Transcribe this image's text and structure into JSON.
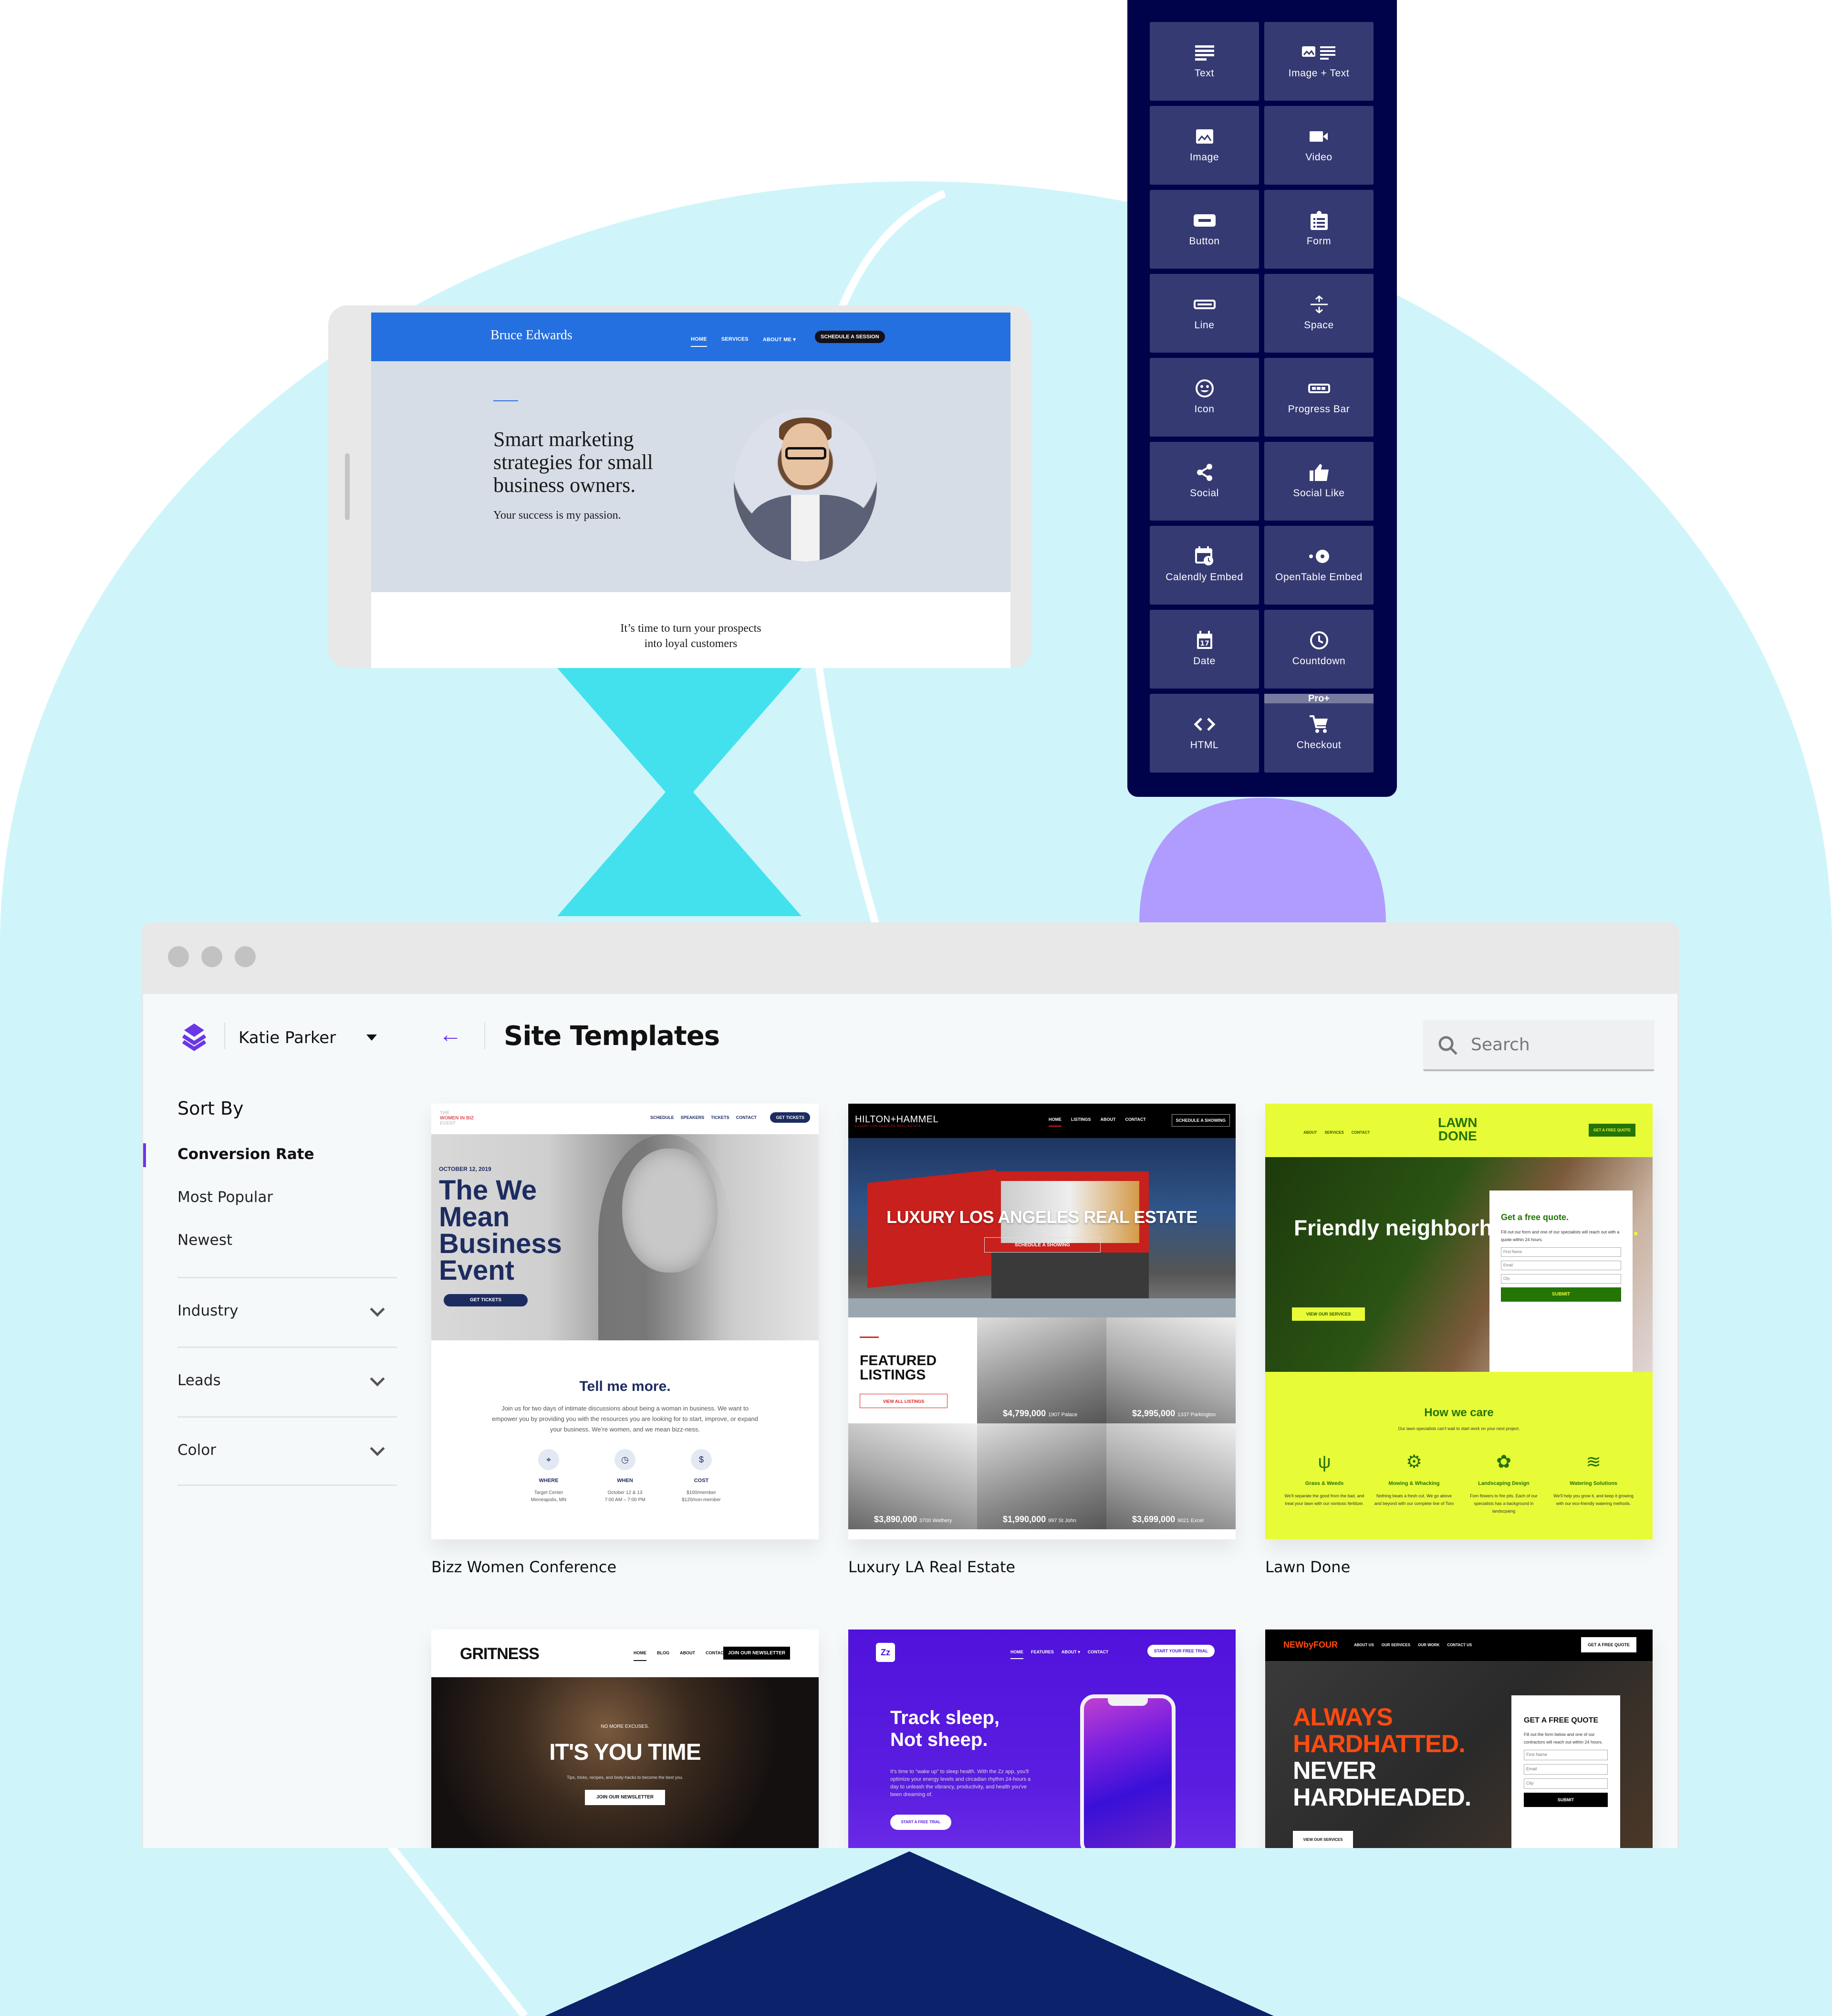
{
  "colors": {
    "background_arch": "#cff5fa",
    "widget_panel": "#00034a",
    "widget_tile": "#363a72",
    "accent_purple": "#6a36e6",
    "hourglass_cyan": "#43e1ee",
    "lavender": "#b09cff",
    "navy_triangle": "#0c226b"
  },
  "tablet_preview": {
    "site_name": "Bruce Edwards",
    "nav": [
      "HOME",
      "SERVICES",
      "ABOUT ME ▾"
    ],
    "cta": "SCHEDULE A SESSION",
    "headline": "Smart marketing strategies for small business owners.",
    "subheadline": "Your success is my passion.",
    "tagline_line1": "It’s time to turn your prospects",
    "tagline_line2": "into loyal customers"
  },
  "widgets": [
    {
      "label": "Text",
      "icon": "text-icon"
    },
    {
      "label": "Image + Text",
      "icon": "image-text-icon"
    },
    {
      "label": "Image",
      "icon": "image-icon"
    },
    {
      "label": "Video",
      "icon": "video-icon"
    },
    {
      "label": "Button",
      "icon": "button-icon"
    },
    {
      "label": "Form",
      "icon": "form-icon"
    },
    {
      "label": "Line",
      "icon": "line-icon"
    },
    {
      "label": "Space",
      "icon": "space-icon"
    },
    {
      "label": "Icon",
      "icon": "smiley-icon"
    },
    {
      "label": "Progress Bar",
      "icon": "progress-bar-icon"
    },
    {
      "label": "Social",
      "icon": "share-icon"
    },
    {
      "label": "Social Like",
      "icon": "thumbs-up-icon"
    },
    {
      "label": "Calendly Embed",
      "icon": "calendar-clock-icon"
    },
    {
      "label": "OpenTable Embed",
      "icon": "opentable-icon"
    },
    {
      "label": "Date",
      "icon": "calendar-icon"
    },
    {
      "label": "Countdown",
      "icon": "clock-icon"
    },
    {
      "label": "HTML",
      "icon": "code-icon"
    },
    {
      "label": "Checkout",
      "icon": "cart-icon",
      "badge": "Pro+"
    }
  ],
  "app": {
    "user_name": "Katie Parker",
    "page_title": "Site Templates",
    "search_placeholder": "Search",
    "sort_by_label": "Sort By",
    "sort_options": [
      {
        "label": "Conversion Rate",
        "active": true
      },
      {
        "label": "Most Popular",
        "active": false
      },
      {
        "label": "Newest",
        "active": false
      }
    ],
    "filters": [
      "Industry",
      "Leads",
      "Color"
    ]
  },
  "templates": [
    {
      "name": "Bizz Women Conference",
      "logo_top": "THE",
      "logo_mid": "WOMEN IN BIZ",
      "logo_bot": "EVENT",
      "nav": [
        "SCHEDULE",
        "SPEAKERS",
        "TICKETS",
        "CONTACT"
      ],
      "cta": "GET TICKETS",
      "date": "OCTOBER 12, 2019",
      "headline": "The We Mean Business Event",
      "hero_button": "GET TICKETS",
      "section_title": "Tell me more.",
      "section_body": "Join us for two days of intimate discussions about being a woman in business. We want to empower you by providing you with the resources you are looking for to start, improve, or expand your business. We’re women, and we mean bizz-ness.",
      "facts": [
        {
          "label": "WHERE",
          "line1": "Target Center",
          "line2": "Minneapolis, MN",
          "icon": "map-pin-icon"
        },
        {
          "label": "WHEN",
          "line1": "October 12 & 13",
          "line2": "7:00 AM – 7:00 PM",
          "icon": "clock-icon"
        },
        {
          "label": "COST",
          "line1": "$100/member",
          "line2": "$120/non-member",
          "icon": "dollar-icon"
        }
      ]
    },
    {
      "name": "Luxury LA Real Estate",
      "logo": "HILTON+HAMMEL",
      "logo_sub": "LUXURY LOS ANGELES REAL ESTATE",
      "nav": [
        "HOME",
        "LISTINGS",
        "ABOUT",
        "CONTACT"
      ],
      "cta": "SCHEDULE A SHOWING",
      "headline": "LUXURY LOS ANGELES REAL ESTATE",
      "hero_button": "SCHEDULE A SHOWING",
      "featured_title_1": "FEATURED",
      "featured_title_2": "LISTINGS",
      "featured_button": "VIEW ALL LISTINGS",
      "listings": [
        {
          "price": "$4,799,000",
          "address": "1907 Palace"
        },
        {
          "price": "$2,995,000",
          "address": "1337 Parkington"
        },
        {
          "price": "$3,890,000",
          "address": "3700 Wethery"
        },
        {
          "price": "$1,990,000",
          "address": "997 St John"
        },
        {
          "price": "$3,699,000",
          "address": "9021 Excel"
        }
      ]
    },
    {
      "name": "Lawn Done",
      "nav": [
        "ABOUT",
        "SERVICES",
        "CONTACT"
      ],
      "logo_1": "LAWN",
      "logo_2": "DONE",
      "cta": "GET A FREE QUOTE",
      "headline": "Friendly neighborhood lawncare",
      "headline_dot": ".",
      "hero_button": "VIEW OUR SERVICES",
      "form_title": "Get a free quote.",
      "form_body": "Fill out our form and one of our specialists will reach out with a quote within 24 hours.",
      "form_fields": [
        "First Name",
        "Email",
        "City"
      ],
      "form_submit": "SUBMIT",
      "care_title": "How we care",
      "care_sub": "Our lawn specialists can't wait to start work on your next project.",
      "services": [
        {
          "title": "Grass & Weeds",
          "desc": "We'll separate the good from the bad, and treat your lawn with our nontoxic fertilizer."
        },
        {
          "title": "Mowing & Whacking",
          "desc": "Nothing beats a fresh cut. We go above and beyond with our complete line of Toro"
        },
        {
          "title": "Landscaping Design",
          "desc": "Fom flowers to fire pits. Each of our specialists has a background in landscpaing"
        },
        {
          "title": "Watering Solutions",
          "desc": "We'll help you grow it, and keep it growing with our eco-friendly watering methods."
        }
      ]
    },
    {
      "name": "Gritness",
      "logo": "GRITNESS",
      "nav": [
        "HOME",
        "BLOG",
        "ABOUT",
        "CONTACT US"
      ],
      "cta": "JOIN OUR NEWSLETTER",
      "kicker": "NO MORE EXCUSES.",
      "headline": "IT'S YOU TIME",
      "sub": "Tips, tricks, recipes, and body-hacks to become the best you.",
      "hero_button": "JOIN OUR NEWSLETTER"
    },
    {
      "name": "Zz",
      "logo": "Zz",
      "nav": [
        "HOME",
        "FEATURES",
        "ABOUT ▾",
        "CONTACT"
      ],
      "cta": "START YOUR FREE TRIAL",
      "headline_1": "Track sleep,",
      "headline_2": "Not sheep.",
      "body": "It's time to \"wake up\" to sleep health. With the Zz app, you'll optimize your energy levels and circadian rhythm 24-hours a day to unleash the vibrancy, productivity, and health you've been dreaming of.",
      "hero_button": "START A FREE TRIAL"
    },
    {
      "name": "NewbyFour",
      "logo": "NEWbyFOUR",
      "nav": [
        "ABOUT US",
        "OUR SERVICES",
        "OUR WORK",
        "CONTACT US"
      ],
      "cta": "GET A FREE QUOTE",
      "headline_1": "ALWAYS",
      "headline_2": "HARDHATTED.",
      "headline_3": "NEVER",
      "headline_4": "HARDHEADED.",
      "hero_button": "VIEW OUR SERVICES",
      "form_title": "GET A FREE QUOTE",
      "form_body": "Fill out the form below and one of our contractors will reach out within 24 hours.",
      "form_fields": [
        "First Name",
        "Email",
        "City"
      ],
      "form_submit": "SUBMIT"
    }
  ]
}
